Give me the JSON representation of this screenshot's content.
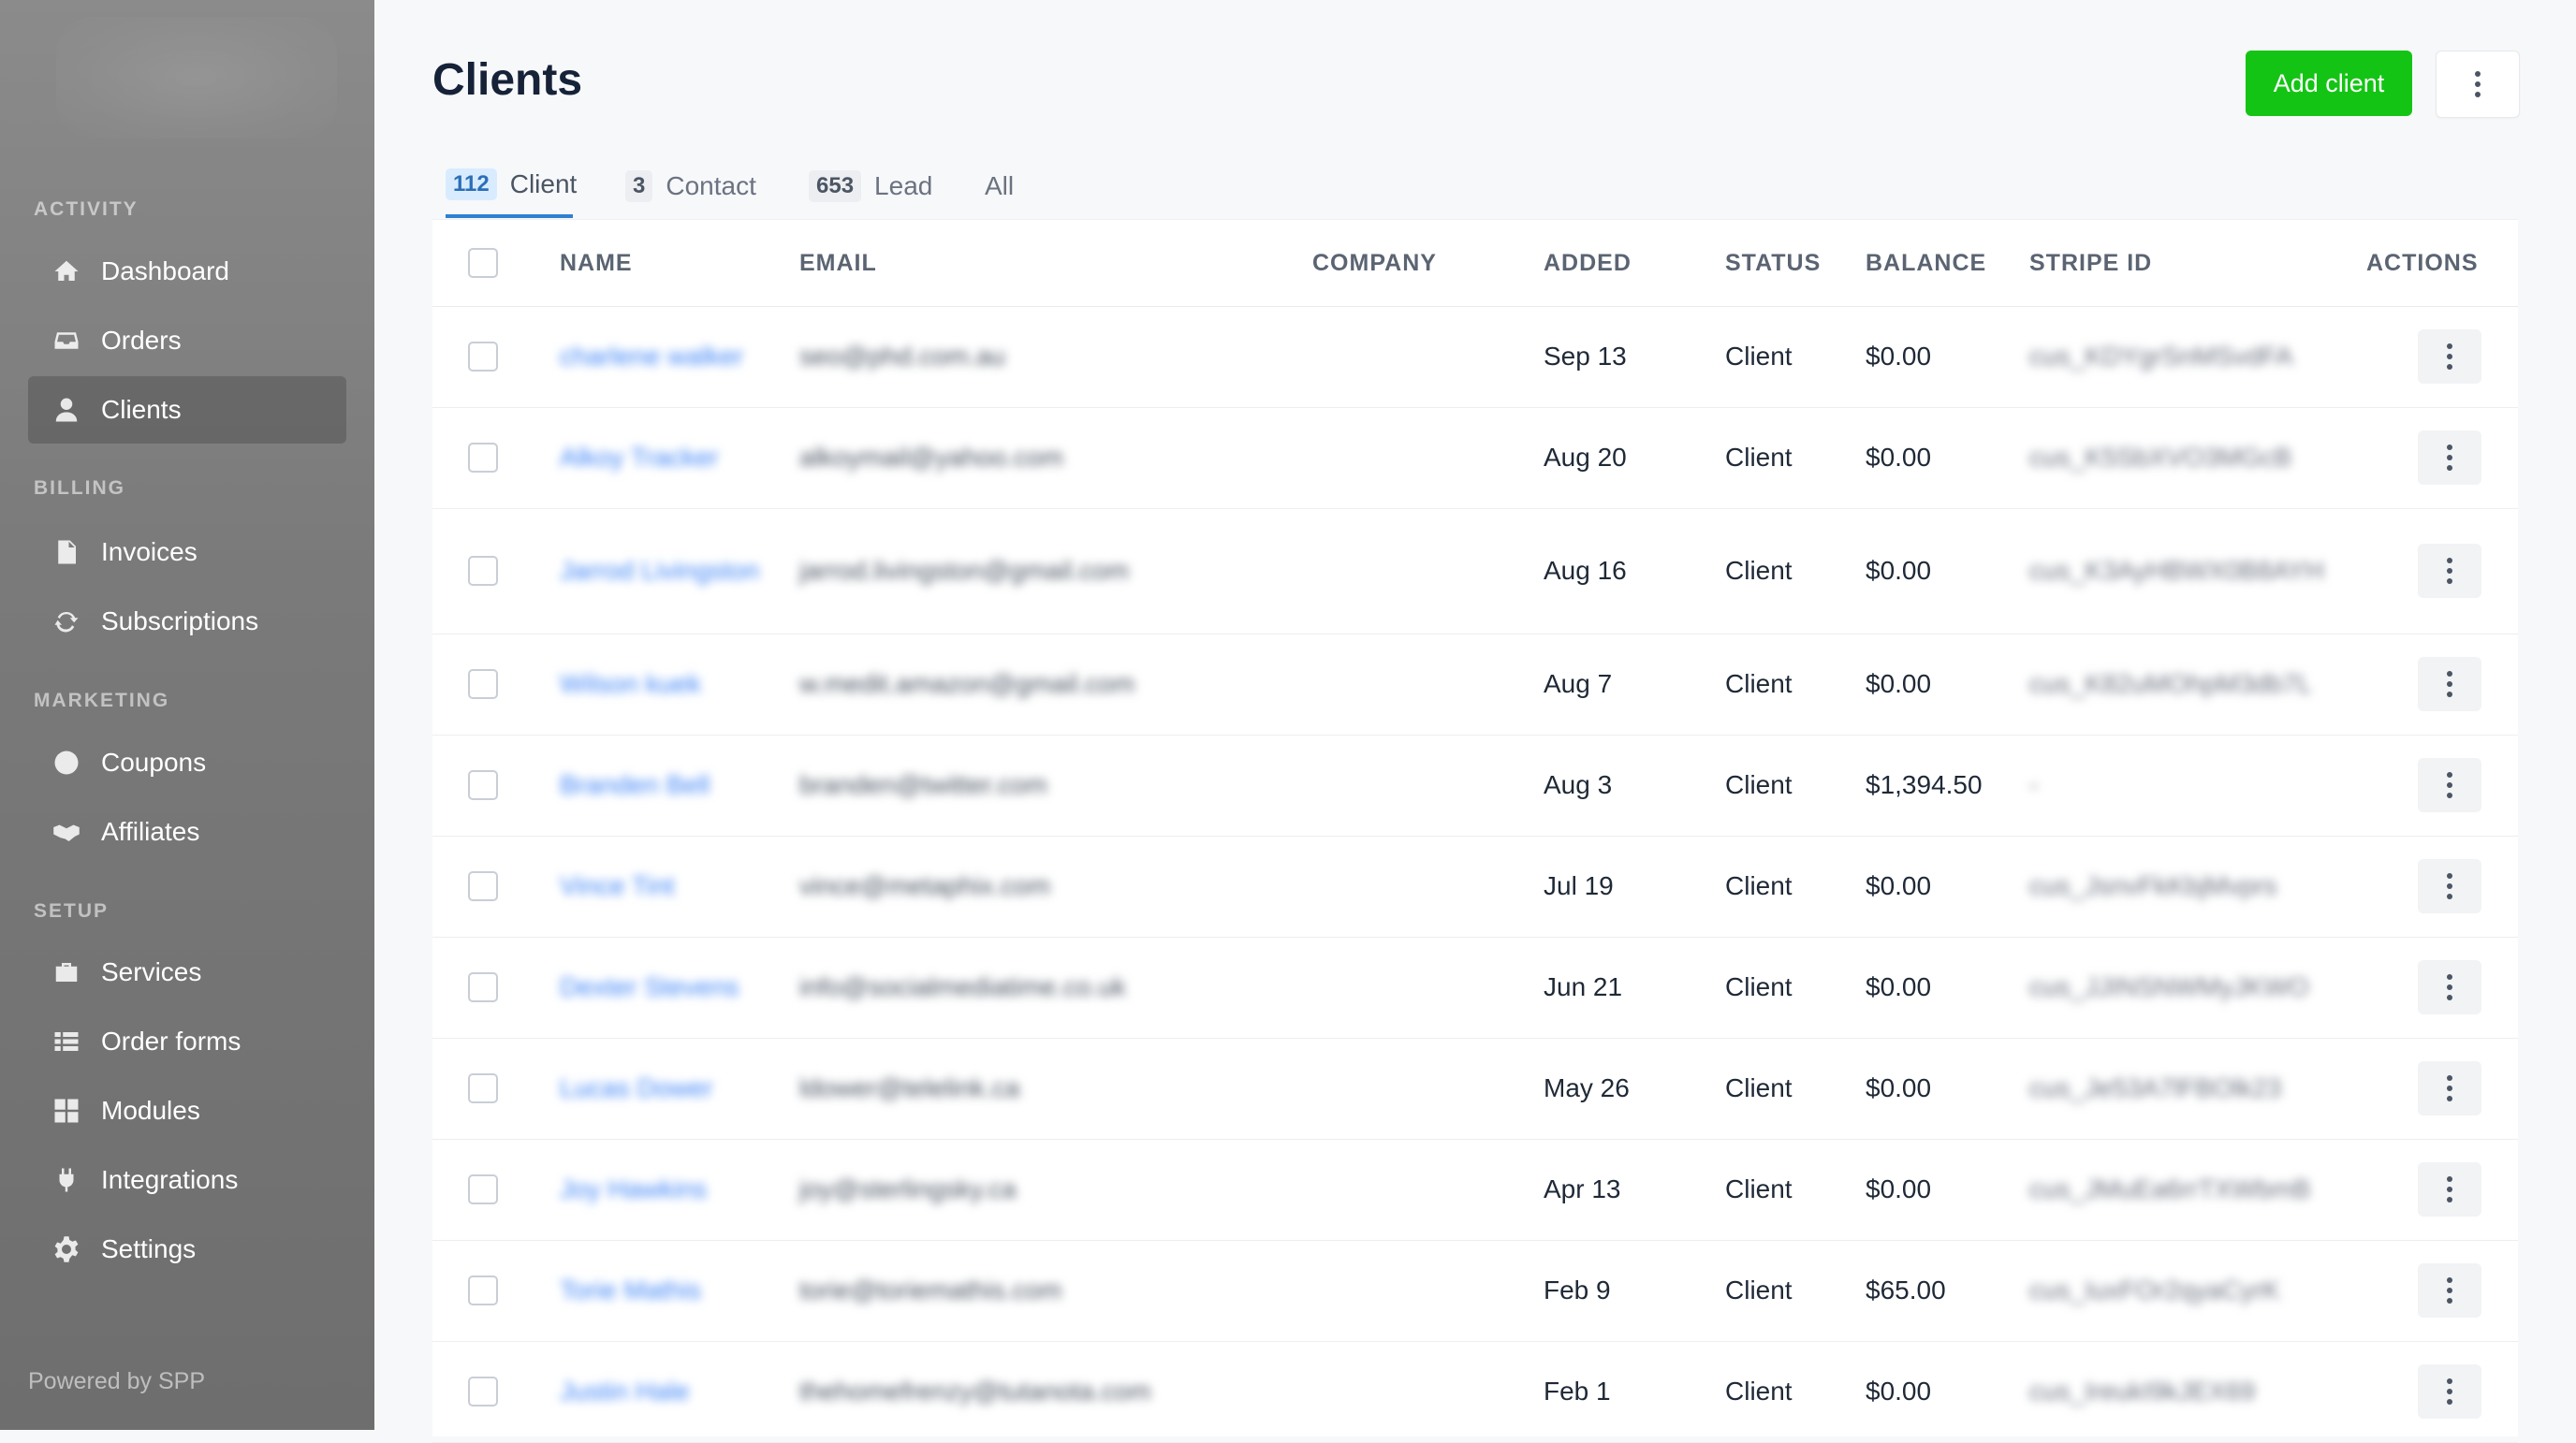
{
  "sidebar": {
    "sections": [
      {
        "title": "ACTIVITY",
        "items": [
          {
            "label": "Dashboard",
            "icon": "home-icon"
          },
          {
            "label": "Orders",
            "icon": "inbox-icon"
          },
          {
            "label": "Clients",
            "icon": "user-icon",
            "active": true
          }
        ]
      },
      {
        "title": "BILLING",
        "items": [
          {
            "label": "Invoices",
            "icon": "document-icon"
          },
          {
            "label": "Subscriptions",
            "icon": "refresh-icon"
          }
        ]
      },
      {
        "title": "MARKETING",
        "items": [
          {
            "label": "Coupons",
            "icon": "coupon-icon"
          },
          {
            "label": "Affiliates",
            "icon": "handshake-icon"
          }
        ]
      },
      {
        "title": "SETUP",
        "items": [
          {
            "label": "Services",
            "icon": "briefcase-icon"
          },
          {
            "label": "Order forms",
            "icon": "list-icon"
          },
          {
            "label": "Modules",
            "icon": "grid-icon"
          },
          {
            "label": "Integrations",
            "icon": "plug-icon"
          },
          {
            "label": "Settings",
            "icon": "gear-icon"
          }
        ]
      }
    ],
    "powered_by": "Powered by SPP"
  },
  "header": {
    "title": "Clients",
    "add_button": "Add client"
  },
  "tabs": [
    {
      "count": "112",
      "label": "Client",
      "active": true
    },
    {
      "count": "3",
      "label": "Contact"
    },
    {
      "count": "653",
      "label": "Lead"
    },
    {
      "count": "",
      "label": "All"
    }
  ],
  "table": {
    "columns": [
      "NAME",
      "EMAIL",
      "COMPANY",
      "ADDED",
      "STATUS",
      "BALANCE",
      "STRIPE ID",
      "ACTIONS"
    ],
    "rows": [
      {
        "name": "charlene walker",
        "email": "seo@phd.com.au",
        "company": "",
        "added": "Sep 13",
        "status": "Client",
        "balance": "$0.00",
        "stripe": "cus_KDYgrSnMSvdFA"
      },
      {
        "name": "Alkoy Tracker",
        "email": "alkoymail@yahoo.com",
        "company": "",
        "added": "Aug 20",
        "status": "Client",
        "balance": "$0.00",
        "stripe": "cus_K5SbXVO3MGcB"
      },
      {
        "name": "Jarrod Livingston",
        "email": "jarrod.livingston@gmail.com",
        "company": "",
        "added": "Aug 16",
        "status": "Client",
        "balance": "$0.00",
        "stripe": "cus_K3AyHBWX0B8AYH"
      },
      {
        "name": "Wilson kuek",
        "email": "w.medit.amazon@gmail.com",
        "company": "",
        "added": "Aug 7",
        "status": "Client",
        "balance": "$0.00",
        "stripe": "cus_K82uMOhpM3db7L"
      },
      {
        "name": "Branden Bell",
        "email": "branden@twitter.com",
        "company": "",
        "added": "Aug 3",
        "status": "Client",
        "balance": "$1,394.50",
        "stripe": "-"
      },
      {
        "name": "Vince Tint",
        "email": "vince@metaphix.com",
        "company": "",
        "added": "Jul 19",
        "status": "Client",
        "balance": "$0.00",
        "stripe": "cus_JsnvFkKbjMvprs"
      },
      {
        "name": "Dexter Stevens",
        "email": "info@socialmediatime.co.uk",
        "company": "",
        "added": "Jun 21",
        "status": "Client",
        "balance": "$0.00",
        "stripe": "cus_JJINSNWMyJKWO"
      },
      {
        "name": "Lucas Dower",
        "email": "ldower@telelink.ca",
        "company": "",
        "added": "May 26",
        "status": "Client",
        "balance": "$0.00",
        "stripe": "cus_Je53A7lFBOlk23"
      },
      {
        "name": "Joy Hawkins",
        "email": "joy@sterlingsky.ca",
        "company": "",
        "added": "Apr 13",
        "status": "Client",
        "balance": "$0.00",
        "stripe": "cus_JMuEa6rrTXWbmB"
      },
      {
        "name": "Torie Mathis",
        "email": "torie@toriemathis.com",
        "company": "",
        "added": "Feb 9",
        "status": "Client",
        "balance": "$65.00",
        "stripe": "cus_IuxFOr2qyaCyrK"
      },
      {
        "name": "Justin Hale",
        "email": "thehomefrenzy@tutanota.com",
        "company": "",
        "added": "Feb 1",
        "status": "Client",
        "balance": "$0.00",
        "stripe": "cus_IreukI9kJEX69"
      }
    ]
  },
  "colors": {
    "accent_green": "#14c414",
    "link_blue": "#3b82f6",
    "tab_active": "#2f80d1"
  }
}
